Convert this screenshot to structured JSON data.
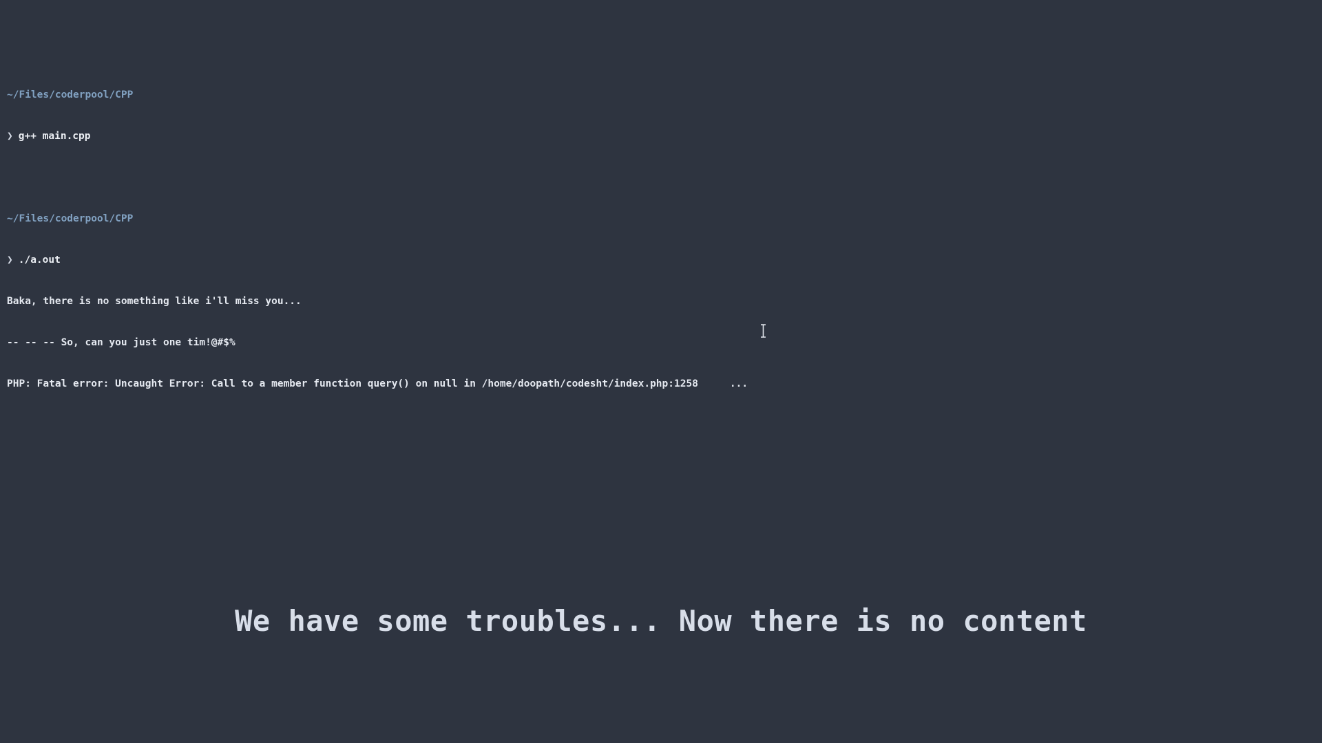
{
  "terminal": {
    "blocks": [
      {
        "path": "~/Files/coderpool/CPP",
        "prompt": "❯",
        "command": "g++ main.cpp"
      },
      {
        "path": "~/Files/coderpool/CPP",
        "prompt": "❯",
        "command": "./a.out",
        "output": [
          "Baka, there is no something like i'll miss you...",
          "-- -- -- So, can you just one tim!@#$%",
          "PHP: Fatal error: Uncaught Error: Call to a member function query() on null in /home/doopath/codesht/index.php:1258"
        ],
        "trailing_ellipsis": "..."
      }
    ]
  },
  "notice": {
    "text": "We have some troubles... Now there is no content"
  },
  "colors": {
    "background": "#2e3440",
    "path": "#81a1c1",
    "text": "#e5e9f0"
  },
  "icons": {
    "mouse_cursor": "text-cursor-icon"
  }
}
